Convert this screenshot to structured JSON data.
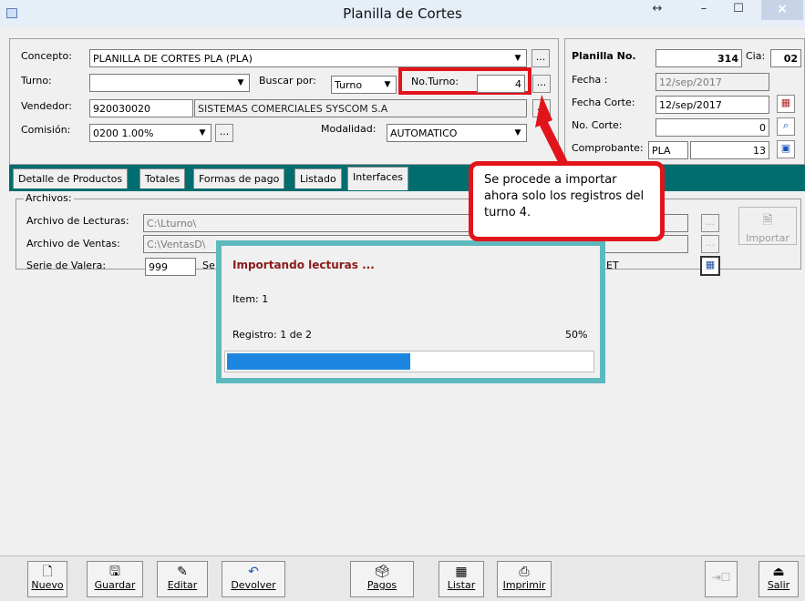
{
  "window": {
    "title": "Planilla de Cortes",
    "resize_icon": "↔",
    "minimize_icon": "–",
    "maximize_icon": "☐",
    "close_icon": "×"
  },
  "header": {
    "concepto_label": "Concepto:",
    "concepto_value": "PLANILLA DE CORTES PLA  (PLA)",
    "turno_label": "Turno:",
    "turno_value": "",
    "buscar_label": "Buscar por:",
    "buscar_value": "Turno",
    "noturno_label": "No.Turno:",
    "noturno_value": "4",
    "vendedor_label": "Vendedor:",
    "vendedor_code": "920030020",
    "vendedor_name": "SISTEMAS COMERCIALES SYSCOM S.A",
    "comision_label": "Comisión:",
    "comision_value": "0200  1.00%",
    "modalidad_label": "Modalidad:",
    "modalidad_value": "AUTOMATICO",
    "ellipsis": "..."
  },
  "planilla": {
    "no_label": "Planilla No.",
    "no_value": "314",
    "cia_label": "Cia:",
    "cia_value": "02",
    "fecha_label": "Fecha :",
    "fecha_value": "12/sep/2017",
    "fecha_corte_label": "Fecha Corte:",
    "fecha_corte_value": "12/sep/2017",
    "no_corte_label": "No. Corte:",
    "no_corte_value": "0",
    "comprobante_label": "Comprobante:",
    "comprobante_code": "PLA",
    "comprobante_value": "13"
  },
  "tabs": [
    "Detalle de Productos",
    "Totales",
    "Formas de pago",
    "Listado",
    "Interfaces"
  ],
  "archivos": {
    "group_label": "Archivos:",
    "lecturas_label": "Archivo de Lecturas:",
    "lecturas_value": "C:\\Lturno\\",
    "ventas_label": "Archivo de Ventas:",
    "ventas_value": "C:\\VentasD\\",
    "serie_label": "Serie de Valera:",
    "serie_value": "999",
    "serie_suffix": "Se",
    "et_fragment": "ET",
    "importar_label": "Importar",
    "ellipsis": "..."
  },
  "progress": {
    "title": "Importando lecturas ...",
    "item": "Item: 1",
    "registro": "Registro: 1 de 2",
    "percent_text": "50%",
    "percent": 0.5
  },
  "callout": {
    "text": "Se procede a importar ahora solo los registros del turno 4."
  },
  "toolbar": {
    "nuevo": "Nuevo",
    "guardar": "Guardar",
    "editar": "Editar",
    "devolver": "Devolver",
    "pagos": "Pagos",
    "listar": "Listar",
    "imprimir": "Imprimir",
    "salir": "Salir"
  },
  "colors": {
    "tab_strip": "#006d6f",
    "dialog_border": "#5db9bd",
    "progress": "#1c86e0",
    "highlight": "#e2141b",
    "title_red": "#8b1a1a"
  }
}
